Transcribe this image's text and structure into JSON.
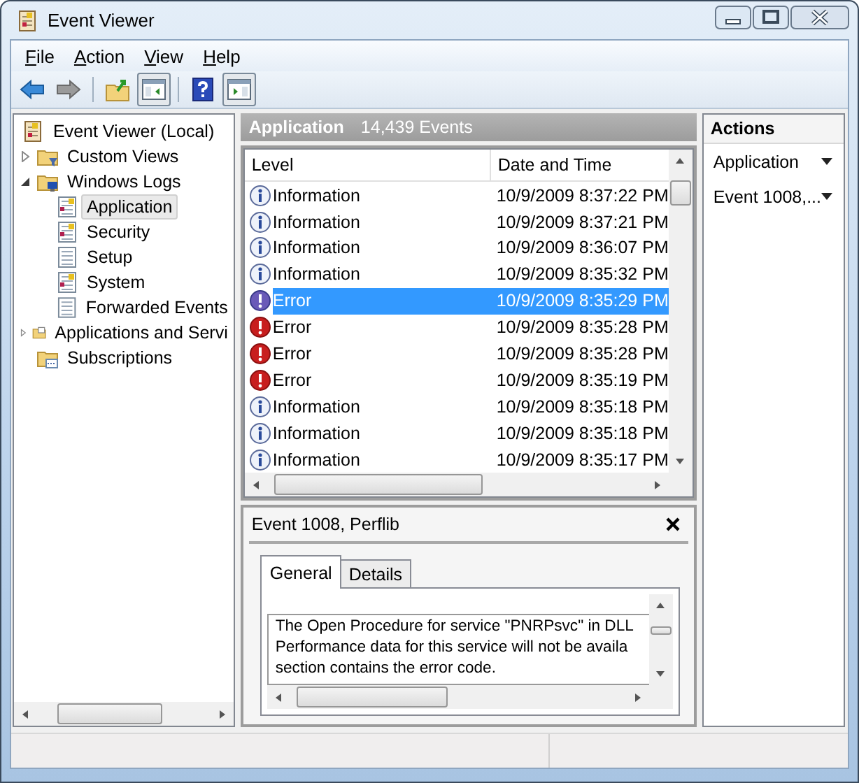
{
  "window": {
    "title": "Event Viewer"
  },
  "menu": [
    {
      "access_key": "F",
      "rest": "ile"
    },
    {
      "access_key": "A",
      "rest": "ction"
    },
    {
      "access_key": "V",
      "rest": "iew"
    },
    {
      "access_key": "H",
      "rest": "elp"
    }
  ],
  "toolbar": [
    {
      "kind": "back",
      "pressed": false
    },
    {
      "kind": "forward",
      "pressed": false
    },
    {
      "kind": "separator"
    },
    {
      "kind": "up-folder",
      "pressed": false
    },
    {
      "kind": "console-tree",
      "pressed": true
    },
    {
      "kind": "separator"
    },
    {
      "kind": "help",
      "pressed": false
    },
    {
      "kind": "action-pane",
      "pressed": true
    }
  ],
  "tree": [
    {
      "label": "Event Viewer (Local)",
      "kind": "viewer",
      "selected": false,
      "children": [
        {
          "label": "Custom Views",
          "kind": "filter-folder",
          "expanded": false,
          "selected": false
        },
        {
          "label": "Windows Logs",
          "kind": "logs-folder",
          "expanded": true,
          "selected": false,
          "children": [
            {
              "label": "Application",
              "kind": "log",
              "selected": true
            },
            {
              "label": "Security",
              "kind": "log",
              "selected": false
            },
            {
              "label": "Setup",
              "kind": "plain-log",
              "selected": false
            },
            {
              "label": "System",
              "kind": "log",
              "selected": false
            },
            {
              "label": "Forwarded Events",
              "kind": "plain-log",
              "selected": false
            }
          ]
        },
        {
          "label": "Applications and Servi",
          "kind": "folder",
          "expanded": false,
          "selected": false
        },
        {
          "label": "Subscriptions",
          "kind": "subscription-folder",
          "selected": false
        }
      ]
    }
  ],
  "log_header": {
    "title": "Application",
    "count": "14,439 Events"
  },
  "events": {
    "columns": [
      "Level",
      "Date and Time"
    ],
    "rows": [
      {
        "kind": "information",
        "level": "Information",
        "date": "10/9/2009 8:37:22 PM",
        "selected": false
      },
      {
        "kind": "information",
        "level": "Information",
        "date": "10/9/2009 8:37:21 PM",
        "selected": false
      },
      {
        "kind": "information",
        "level": "Information",
        "date": "10/9/2009 8:36:07 PM",
        "selected": false
      },
      {
        "kind": "information",
        "level": "Information",
        "date": "10/9/2009 8:35:32 PM",
        "selected": false
      },
      {
        "kind": "error",
        "level": "Error",
        "date": "10/9/2009 8:35:29 PM",
        "selected": true
      },
      {
        "kind": "error",
        "level": "Error",
        "date": "10/9/2009 8:35:28 PM",
        "selected": false
      },
      {
        "kind": "error",
        "level": "Error",
        "date": "10/9/2009 8:35:28 PM",
        "selected": false
      },
      {
        "kind": "error",
        "level": "Error",
        "date": "10/9/2009 8:35:19 PM",
        "selected": false
      },
      {
        "kind": "information",
        "level": "Information",
        "date": "10/9/2009 8:35:18 PM",
        "selected": false
      },
      {
        "kind": "information",
        "level": "Information",
        "date": "10/9/2009 8:35:18 PM",
        "selected": false
      },
      {
        "kind": "information",
        "level": "Information",
        "date": "10/9/2009 8:35:17 PM",
        "selected": false
      }
    ]
  },
  "detail": {
    "title": "Event 1008, Perflib",
    "tabs": [
      {
        "label": "General",
        "selected": true
      },
      {
        "label": "Details",
        "selected": false
      }
    ],
    "description": [
      "The Open Procedure for service \"PNRPsvc\" in DLL",
      "Performance data for this service will not be availa",
      "section contains the error code."
    ]
  },
  "actions": {
    "title": "Actions",
    "items": [
      "Application",
      "Event 1008,..."
    ]
  }
}
